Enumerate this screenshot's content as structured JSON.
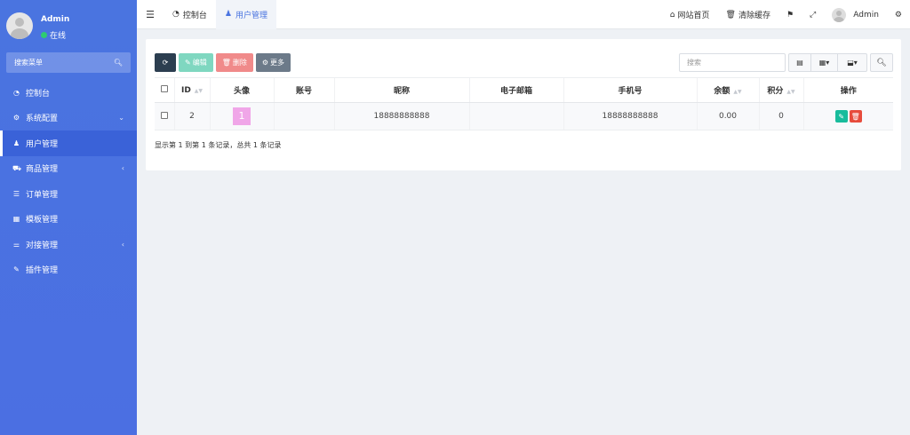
{
  "sidebar": {
    "user_name": "Admin",
    "status": "在线",
    "search_placeholder": "搜索菜单",
    "items": [
      {
        "label": "控制台",
        "icon": "dashboard-icon",
        "glyph": "◔",
        "arrow": ""
      },
      {
        "label": "系统配置",
        "icon": "gear-icon",
        "glyph": "⚙",
        "arrow": "⌄"
      },
      {
        "label": "用户管理",
        "icon": "user-icon",
        "glyph": "♟",
        "arrow": ""
      },
      {
        "label": "商品管理",
        "icon": "cart-icon",
        "glyph": "⛟",
        "arrow": "‹"
      },
      {
        "label": "订单管理",
        "icon": "list-icon",
        "glyph": "☰",
        "arrow": ""
      },
      {
        "label": "模板管理",
        "icon": "keyboard-icon",
        "glyph": "▦",
        "arrow": ""
      },
      {
        "label": "对接管理",
        "icon": "sliders-icon",
        "glyph": "⚌",
        "arrow": "‹"
      },
      {
        "label": "插件管理",
        "icon": "plug-icon",
        "glyph": "✎",
        "arrow": ""
      }
    ]
  },
  "topbar": {
    "tabs": [
      {
        "label": "控制台",
        "icon": "dashboard-icon"
      },
      {
        "label": "用户管理",
        "icon": "user-icon"
      }
    ],
    "home_label": "网站首页",
    "clear_cache_label": "清除缓存",
    "user_name": "Admin"
  },
  "toolbar": {
    "edit_label": "编辑",
    "delete_label": "删除",
    "more_label": "更多",
    "search_placeholder": "搜索"
  },
  "table": {
    "headers": [
      "ID",
      "头像",
      "账号",
      "昵称",
      "电子邮箱",
      "手机号",
      "余额",
      "积分",
      "操作"
    ],
    "rows": [
      {
        "id": "2",
        "avatar": "1",
        "account": "",
        "nickname": "18888888888",
        "email": "",
        "phone": "18888888888",
        "balance": "0.00",
        "points": "0"
      }
    ]
  },
  "pagination": {
    "summary": "显示第 1 到第 1 条记录，总共 1 条记录"
  },
  "colors": {
    "sidebar": "#4a74e0",
    "accent": "#4a74e0",
    "edit": "#18bc9c",
    "delete": "#e74c3c",
    "avatar_badge": "#f0a6e8"
  }
}
